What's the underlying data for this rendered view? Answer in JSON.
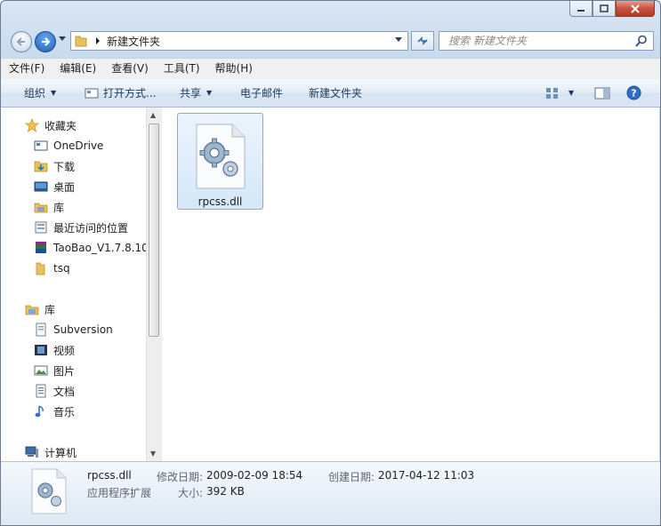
{
  "window": {
    "folder_name": "新建文件夹"
  },
  "search": {
    "placeholder": "搜索 新建文件夹"
  },
  "menu": [
    "文件(F)",
    "编辑(E)",
    "查看(V)",
    "工具(T)",
    "帮助(H)"
  ],
  "commands": {
    "organize": "组织",
    "open_with": "打开方式...",
    "share": "共享",
    "email": "电子邮件",
    "new_folder": "新建文件夹"
  },
  "nav": {
    "favorites": "收藏夹",
    "favorites_items": [
      "OneDrive",
      "下载",
      "桌面",
      "库",
      "最近访问的位置",
      "TaoBao_V1.7.8.10_",
      "tsq"
    ],
    "libraries": "库",
    "libraries_items": [
      "Subversion",
      "视频",
      "图片",
      "文档",
      "音乐"
    ],
    "computer": "计算机"
  },
  "files": [
    {
      "name": "rpcss.dll",
      "icon": "dll-gear-icon"
    }
  ],
  "details": {
    "name": "rpcss.dll",
    "type": "应用程序扩展",
    "modified_label": "修改日期:",
    "modified": "2009-02-09 18:54",
    "created_label": "创建日期:",
    "created": "2017-04-12 11:03",
    "size_label": "大小:",
    "size": "392 KB"
  },
  "colors": {
    "accent": "#1d5fb4",
    "selection": "#d5e7fa",
    "close": "#c75340"
  }
}
